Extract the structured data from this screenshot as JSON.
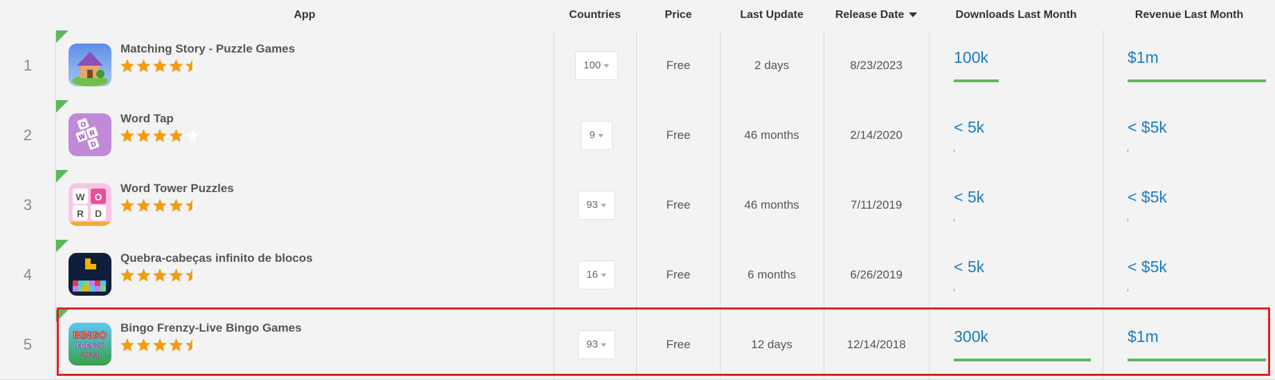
{
  "columns": {
    "app": "App",
    "countries": "Countries",
    "price": "Price",
    "last_update": "Last Update",
    "release_date": "Release Date",
    "downloads": "Downloads Last Month",
    "revenue": "Revenue Last Month"
  },
  "sort": {
    "column": "Release Date",
    "direction": "descending"
  },
  "colors": {
    "accent_link": "#1a7bbf",
    "bar": "#5cb85c",
    "star": "#f39c12",
    "highlight": "#e02020"
  },
  "rows": [
    {
      "rank": "1",
      "name": "Matching Story - Puzzle Games",
      "rating": 4.5,
      "countries": "100",
      "price": "Free",
      "last_update": "2 days",
      "release_date": "8/23/2023",
      "downloads": "100k",
      "downloads_level": 0.33,
      "revenue": "$1m",
      "revenue_level": 1.0
    },
    {
      "rank": "2",
      "name": "Word Tap",
      "rating": 4.0,
      "countries": "9",
      "price": "Free",
      "last_update": "46 months",
      "release_date": "2/14/2020",
      "downloads": "< 5k",
      "downloads_level": 0.0,
      "revenue": "< $5k",
      "revenue_level": 0.0
    },
    {
      "rank": "3",
      "name": "Word Tower Puzzles",
      "rating": 4.5,
      "countries": "93",
      "price": "Free",
      "last_update": "46 months",
      "release_date": "7/11/2019",
      "downloads": "< 5k",
      "downloads_level": 0.0,
      "revenue": "< $5k",
      "revenue_level": 0.0
    },
    {
      "rank": "4",
      "name": "Quebra-cabeças infinito de blocos",
      "rating": 4.5,
      "countries": "16",
      "price": "Free",
      "last_update": "6 months",
      "release_date": "6/26/2019",
      "downloads": "< 5k",
      "downloads_level": 0.0,
      "revenue": "< $5k",
      "revenue_level": 0.0
    },
    {
      "rank": "5",
      "name": "Bingo Frenzy-Live Bingo Games",
      "rating": 4.5,
      "countries": "93",
      "price": "Free",
      "last_update": "12 days",
      "release_date": "12/14/2018",
      "downloads": "300k",
      "downloads_level": 1.0,
      "revenue": "$1m",
      "revenue_level": 1.0,
      "selected": true
    }
  ],
  "icons": [
    "matching-story-app-icon",
    "word-tap-app-icon",
    "word-tower-app-icon",
    "block-puzzle-app-icon",
    "bingo-frenzy-app-icon"
  ],
  "icon_text": {
    "bingo": "BINGO",
    "frenzy": "FRENZY",
    "year": "2024",
    "word_tiles": "WORD"
  }
}
